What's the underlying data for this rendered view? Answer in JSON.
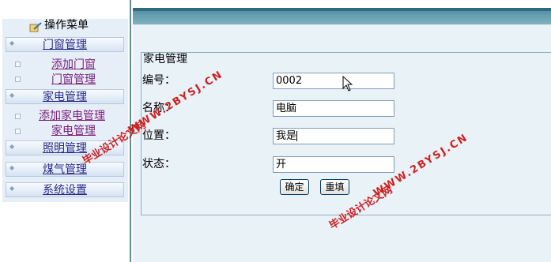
{
  "sidebar": {
    "title": "操作菜单",
    "groups": [
      {
        "label": "门窗管理",
        "items": [
          "添加门窗",
          "门窗管理"
        ]
      },
      {
        "label": "家电管理",
        "items": [
          "添加家电管理",
          "家电管理"
        ]
      },
      {
        "label": "照明管理",
        "items": []
      },
      {
        "label": "煤气管理",
        "items": []
      },
      {
        "label": "系统设置",
        "items": []
      }
    ]
  },
  "form": {
    "legend": "家电管理",
    "fields": [
      {
        "label": "编号：",
        "value": "0002"
      },
      {
        "label": "名称：",
        "value": "电脑"
      },
      {
        "label": "位置：",
        "value": "我是"
      },
      {
        "label": "状态：",
        "value": "开"
      }
    ],
    "buttons": {
      "confirm": "确定",
      "reset": "重填"
    }
  },
  "watermarks": {
    "url": "WWW.2BYSJ.CN",
    "site": "毕业设计论文网"
  },
  "colors": {
    "header_bar": "#4f8da0",
    "menu_link": "#2a2a8a",
    "visited_link": "#7a1e7a",
    "watermark": "#cc2222",
    "content_bg": "#e9f2f7"
  }
}
